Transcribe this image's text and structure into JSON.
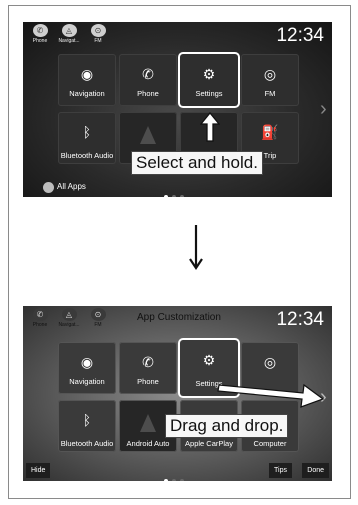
{
  "step1": {
    "shortcuts": [
      {
        "icon": "phone-icon",
        "label": "Phone"
      },
      {
        "icon": "navigation-icon",
        "label": "Navigat..."
      },
      {
        "icon": "fm-icon",
        "label": "FM"
      }
    ],
    "clock": "12:34",
    "tiles": [
      {
        "name": "navigation",
        "icon": "navigation-icon",
        "label": "Navigation"
      },
      {
        "name": "phone",
        "icon": "phone-icon",
        "label": "Phone"
      },
      {
        "name": "settings",
        "icon": "gear-icon",
        "label": "Settings"
      },
      {
        "name": "fm",
        "icon": "fm-icon",
        "label": "FM"
      },
      {
        "name": "bluetooth-audio",
        "icon": "bluetooth-icon",
        "label": "Bluetooth Audio"
      },
      {
        "name": "android-auto",
        "icon": "android-auto-icon",
        "label": ""
      },
      {
        "name": "apple-carplay",
        "icon": "carplay-icon",
        "label": ""
      },
      {
        "name": "trip",
        "icon": "fuel-icon",
        "label": "Trip"
      }
    ],
    "all_apps": "All Apps",
    "callout": "Select and hold."
  },
  "step2": {
    "shortcuts": [
      {
        "icon": "phone-icon",
        "label": "Phone"
      },
      {
        "icon": "navigation-icon",
        "label": "Navigat..."
      },
      {
        "icon": "fm-icon",
        "label": "FM"
      }
    ],
    "title": "App Customization",
    "clock": "12:34",
    "tiles": [
      {
        "name": "navigation",
        "icon": "navigation-icon",
        "label": "Navigation"
      },
      {
        "name": "phone",
        "icon": "phone-icon",
        "label": "Phone"
      },
      {
        "name": "settings",
        "icon": "gear-icon",
        "label": "Settings"
      },
      {
        "name": "fm",
        "icon": "fm-icon",
        "label": ""
      },
      {
        "name": "bluetooth-audio",
        "icon": "bluetooth-icon",
        "label": "Bluetooth Audio"
      },
      {
        "name": "android-auto",
        "icon": "android-auto-icon",
        "label": "Android Auto"
      },
      {
        "name": "apple-carplay",
        "icon": "carplay-icon",
        "label": "Apple CarPlay"
      },
      {
        "name": "computer",
        "icon": "computer-icon",
        "label": "Computer"
      }
    ],
    "hide": "Hide",
    "tips": "Tips",
    "done": "Done",
    "callout": "Drag and drop."
  },
  "colors": {
    "highlight": "#ffffff",
    "screen_dark": "#1d1d1d"
  }
}
